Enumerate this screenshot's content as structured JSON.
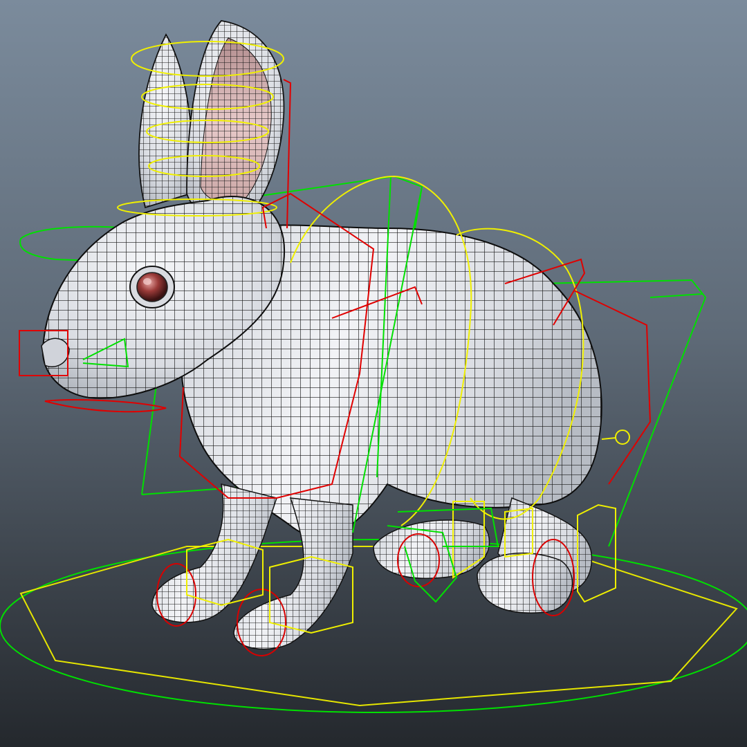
{
  "viewport": {
    "background_top": "#7b8b9c",
    "background_bottom": "#24282d"
  },
  "model": {
    "body_color": "#e6e8ec",
    "wire_color": "#111111",
    "ear_inner_color": "#caa7a6",
    "eye_color": "#8b2a2a"
  },
  "rig_controls": {
    "fk_color": "#ffff00",
    "ik_color": "#00ff00",
    "spline_color": "#ff0000"
  }
}
